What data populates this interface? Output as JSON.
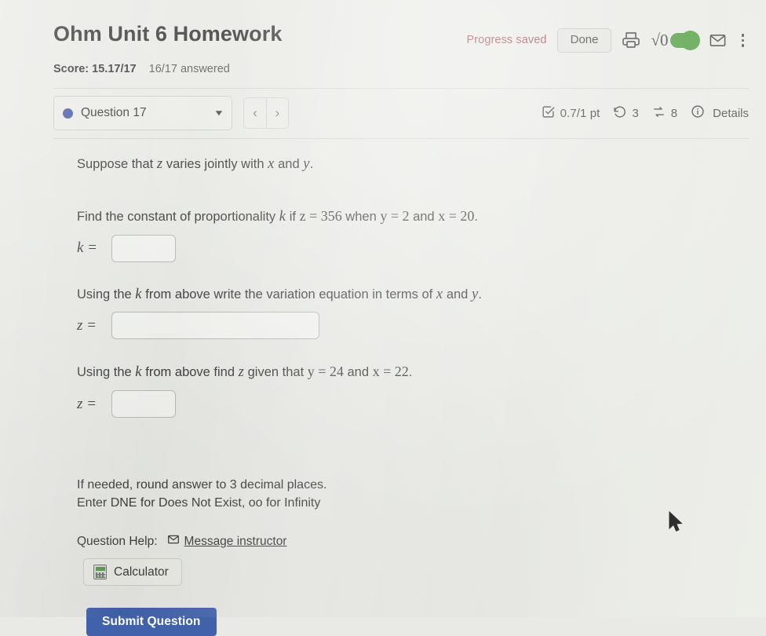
{
  "header": {
    "title": "Ohm Unit 6 Homework",
    "score_label": "Score: 15.17/17",
    "answered_label": "16/17 answered",
    "progress_saved": "Progress saved",
    "done_label": "Done",
    "icons": {
      "print": "print-icon",
      "sqrt": "√0",
      "math_toggle_state": "on",
      "mail": "mail-icon",
      "menu": "kebab-menu-icon"
    },
    "colors": {
      "progress_saved": "#9c4a4a",
      "toggle_on": "#4c9a3c",
      "question_dot": "#4a5ba6",
      "submit": "#4162ab"
    }
  },
  "question_bar": {
    "question_label": "Question 17",
    "dropdown_caret": "▼",
    "prev_label": "‹",
    "next_label": "›",
    "points": "0.7/1 pt",
    "attempts_count": "3",
    "versions_count": "8",
    "details_label": "Details"
  },
  "problem": {
    "line1": {
      "a": "Suppose that ",
      "v1": "z",
      "b": " varies jointly with ",
      "v2": "x",
      "c": " and ",
      "v3": "y",
      "d": "."
    },
    "line2": {
      "a": "Find the constant of proportionality ",
      "k": "k",
      "b": " if ",
      "zeq": "z = 356",
      "c": " when ",
      "yeq": "y = 2",
      "d": " and ",
      "xeq": "x = 20",
      "e": "."
    },
    "answer1": {
      "label": "k =",
      "value": "",
      "placeholder": ""
    },
    "line3": {
      "a": "Using the ",
      "k": "k",
      "b": " from above write the variation equation in terms of ",
      "v1": "x",
      "c": " and ",
      "v2": "y",
      "d": "."
    },
    "answer2": {
      "label": "z =",
      "value": "",
      "placeholder": ""
    },
    "line4": {
      "a": "Using the ",
      "k": "k",
      "b": " from above find ",
      "z": "z",
      "c": " given that ",
      "yeq": "y = 24",
      "d": " and ",
      "xeq": "x = 22",
      "e": "."
    },
    "answer3": {
      "label": "z =",
      "value": "",
      "placeholder": ""
    },
    "note_line1": "If needed, round answer to 3 decimal places.",
    "note_line2": "Enter DNE for Does Not Exist, oo for Infinity"
  },
  "footer": {
    "question_help_label": "Question Help:",
    "message_instructor": "Message instructor",
    "calculator_label": "Calculator",
    "submit_label": "Submit Question"
  }
}
